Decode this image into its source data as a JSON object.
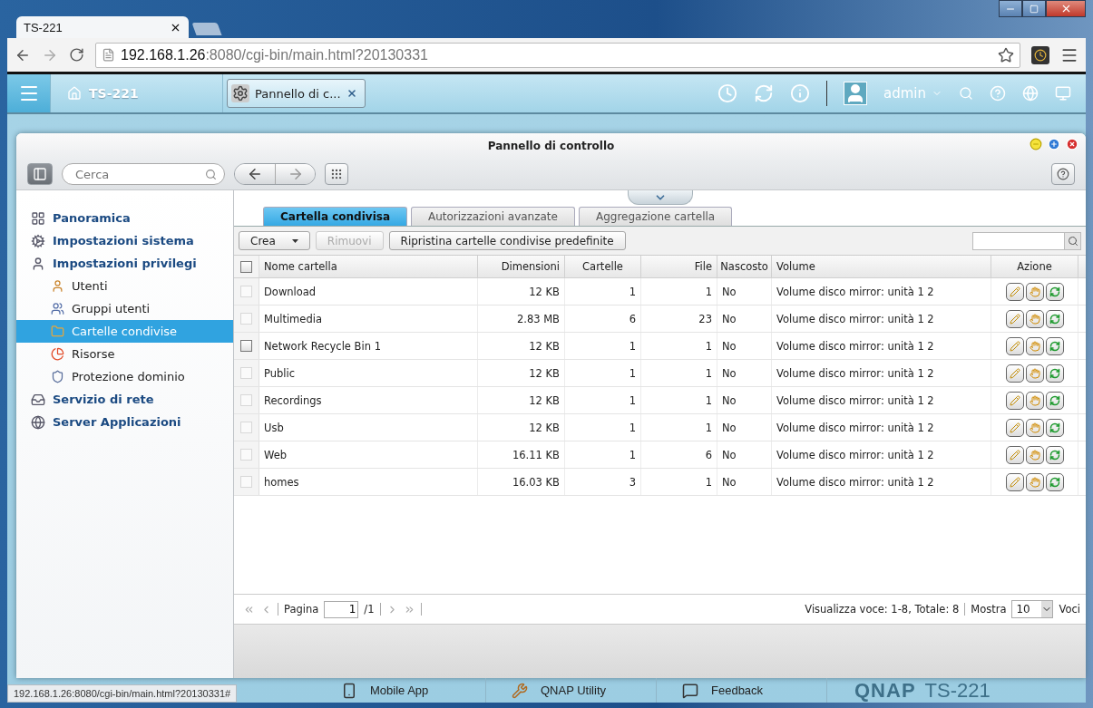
{
  "browser": {
    "tab_title": "TS-221",
    "url_host": "192.168.1.26",
    "url_path": ":8080/cgi-bin/main.html?20130331"
  },
  "app_header": {
    "home_label": "TS-221",
    "open_app": "Pannello di c...",
    "user": "admin"
  },
  "window": {
    "title": "Pannello di controllo",
    "search_placeholder": "Cerca"
  },
  "sidebar": {
    "items": [
      {
        "label": "Panoramica",
        "selected": false
      },
      {
        "label": "Impostazioni sistema",
        "selected": false
      },
      {
        "label": "Impostazioni privilegi",
        "selected": false,
        "children": [
          {
            "label": "Utenti",
            "selected": false
          },
          {
            "label": "Gruppi utenti",
            "selected": false
          },
          {
            "label": "Cartelle condivise",
            "selected": true
          },
          {
            "label": "Risorse",
            "selected": false
          },
          {
            "label": "Protezione dominio",
            "selected": false
          }
        ]
      },
      {
        "label": "Servizio di rete",
        "selected": false
      },
      {
        "label": "Server Applicazioni",
        "selected": false
      }
    ]
  },
  "tabs": [
    {
      "label": "Cartella condivisa",
      "selected": true
    },
    {
      "label": "Autorizzazioni avanzate",
      "selected": false
    },
    {
      "label": "Aggregazione cartella",
      "selected": false
    }
  ],
  "toolbar": {
    "buttons": [
      {
        "label": "Crea",
        "kind": "dropdown",
        "disabled": false
      },
      {
        "label": "Rimuovi",
        "kind": "plain",
        "disabled": true
      },
      {
        "label": "Ripristina cartelle condivise predefinite",
        "kind": "plain",
        "disabled": false
      }
    ]
  },
  "table": {
    "select_all_checked": false,
    "columns": [
      "Nome cartella",
      "Dimensioni",
      "Cartelle",
      "File",
      "Nascosto",
      "Volume",
      "Azione"
    ],
    "rows": [
      {
        "name": "Download",
        "size": "12 KB",
        "folders": "1",
        "files": "1",
        "hidden": "No",
        "volume": "Volume disco mirror: unità 1 2",
        "checked": false,
        "disabled": true
      },
      {
        "name": "Multimedia",
        "size": "2.83 MB",
        "folders": "6",
        "files": "23",
        "hidden": "No",
        "volume": "Volume disco mirror: unità 1 2",
        "checked": false,
        "disabled": true
      },
      {
        "name": "Network Recycle Bin 1",
        "size": "12 KB",
        "folders": "1",
        "files": "1",
        "hidden": "No",
        "volume": "Volume disco mirror: unità 1 2",
        "checked": false,
        "disabled": false
      },
      {
        "name": "Public",
        "size": "12 KB",
        "folders": "1",
        "files": "1",
        "hidden": "No",
        "volume": "Volume disco mirror: unità 1 2",
        "checked": false,
        "disabled": true
      },
      {
        "name": "Recordings",
        "size": "12 KB",
        "folders": "1",
        "files": "1",
        "hidden": "No",
        "volume": "Volume disco mirror: unità 1 2",
        "checked": false,
        "disabled": true
      },
      {
        "name": "Usb",
        "size": "12 KB",
        "folders": "1",
        "files": "1",
        "hidden": "No",
        "volume": "Volume disco mirror: unità 1 2",
        "checked": false,
        "disabled": true
      },
      {
        "name": "Web",
        "size": "16.11 KB",
        "folders": "1",
        "files": "6",
        "hidden": "No",
        "volume": "Volume disco mirror: unità 1 2",
        "checked": false,
        "disabled": true
      },
      {
        "name": "homes",
        "size": "16.03 KB",
        "folders": "3",
        "files": "1",
        "hidden": "No",
        "volume": "Volume disco mirror: unità 1 2",
        "checked": false,
        "disabled": true
      }
    ]
  },
  "pager": {
    "page_label": "Pagina",
    "page": "1",
    "total_pages": "/1",
    "summary": "Visualizza voce: 1-8, Totale: 8",
    "show_label": "Mostra",
    "per_page": "10",
    "items_label": "Voci"
  },
  "desktop": {
    "shortcuts": [
      "Mobile App",
      "QNAP Utility",
      "Feedback"
    ],
    "logo": "QNAP",
    "model": "TS-221"
  },
  "status_url": "192.168.1.26:8080/cgi-bin/main.html?20130331#"
}
